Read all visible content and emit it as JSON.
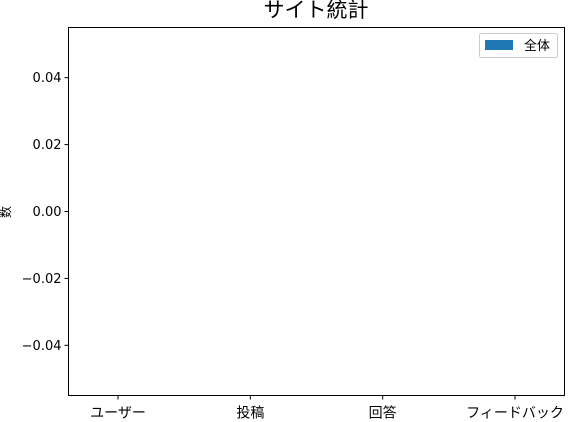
{
  "chart_data": {
    "type": "bar",
    "title": "サイト統計",
    "xlabel": "",
    "ylabel": "数",
    "categories": [
      "ユーザー",
      "投稿",
      "回答",
      "フィードバック"
    ],
    "series": [
      {
        "name": "全体",
        "values": [
          0,
          0,
          0,
          0
        ],
        "color": "#1f77b4"
      }
    ],
    "ylim": [
      -0.055,
      0.055
    ],
    "yticks": [
      {
        "value": 0.04,
        "label": "0.04"
      },
      {
        "value": 0.02,
        "label": "0.02"
      },
      {
        "value": 0.0,
        "label": "0.00"
      },
      {
        "value": -0.02,
        "label": "−0.02"
      },
      {
        "value": -0.04,
        "label": "−0.04"
      }
    ],
    "grid": false,
    "legend": "top-right"
  }
}
